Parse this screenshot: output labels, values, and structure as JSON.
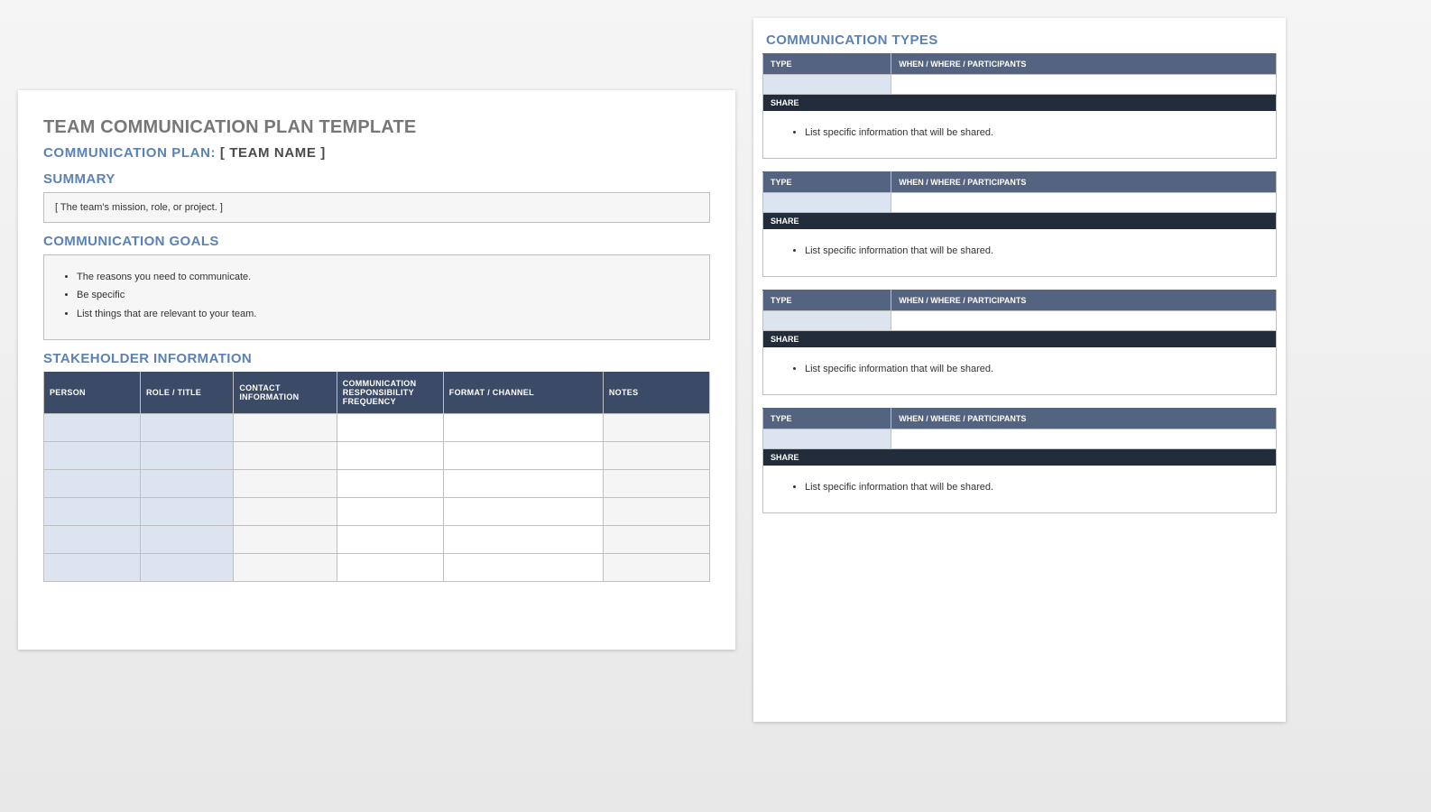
{
  "page1": {
    "title": "TEAM COMMUNICATION PLAN TEMPLATE",
    "subtitle_prefix": "COMMUNICATION PLAN:",
    "subtitle_team": "[ TEAM NAME ]",
    "summary_heading": "SUMMARY",
    "summary_text": "[ The team's mission, role, or project. ]",
    "goals_heading": "COMMUNICATION GOALS",
    "goals": [
      "The reasons you need to communicate.",
      "Be specific",
      "List things that are relevant to your team."
    ],
    "stakeholder_heading": "STAKEHOLDER INFORMATION",
    "stakeholder_cols": [
      "PERSON",
      "ROLE / TITLE",
      "CONTACT INFORMATION",
      "COMMUNICATION RESPONSIBILITY FREQUENCY",
      "FORMAT / CHANNEL",
      "NOTES"
    ],
    "stakeholder_rowcount": 6
  },
  "page2": {
    "title": "COMMUNICATION TYPES",
    "type_col": "TYPE",
    "wwp_col": "WHEN / WHERE / PARTICIPANTS",
    "share_label": "SHARE",
    "share_item": "List specific information that will be shared.",
    "block_count": 4
  }
}
